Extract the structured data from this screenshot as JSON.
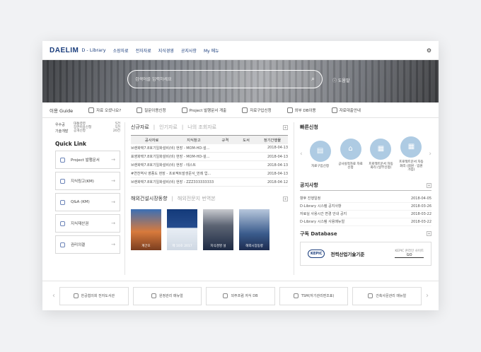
{
  "header": {
    "logo": "DAELIM",
    "logo_sub": "D - Library",
    "nav": [
      "소장자료",
      "전자자료",
      "지식경영",
      "공지사항",
      "My 메뉴"
    ]
  },
  "hero": {
    "search_placeholder": "검색어를 입력하세요",
    "help": "ⓘ 도움말"
  },
  "quickbar": {
    "guide": "이용 Guide",
    "items": [
      "자료 오셨나요?",
      "질문이용신청",
      "Project 발행문서 게출",
      "자료구입신청",
      "외부 DB이용",
      "자료대출안내"
    ]
  },
  "left": {
    "winner_tag1": "우수공",
    "winner_tag2": "기술개발",
    "winner_list": [
      {
        "name": "대통령령",
        "n": "5건"
      },
      {
        "name": "장관이용신청",
        "n": "5건"
      },
      {
        "name": "공개신청",
        "n": "20건"
      }
    ],
    "quicklink_title": "Quick Link",
    "quicklinks": [
      "Project 발행문서",
      "지식링고(KM)",
      "Q&A (KM)",
      "지식재산권",
      "권리의결"
    ]
  },
  "center": {
    "tabs": {
      "active": "신규자료",
      "t2": "인기자료",
      "t3": "나의 조회자료"
    },
    "table_headers": [
      "공사자료",
      "지식창고",
      "규격",
      "도서",
      "정기간행물"
    ],
    "rows": [
      {
        "title": "브랜화택7.8호기일화설비(비) 현장 - MOM-HD-설...",
        "date": "2018-04-13"
      },
      {
        "title": "표영화택7.8호기일화설비(비) 현장 - MOM-HD-설...",
        "date": "2018-04-13"
      },
      {
        "title": "브랜화택7.8호기일화설비(비) 현장 - 테스트",
        "date": "2018-04-13"
      },
      {
        "title": "#연천역사 영종도 현장 - 프로젝트발생문서_번례 업...",
        "date": "2018-04-13"
      },
      {
        "title": "브랜화택7.8호기일화설비(비) 현장 - ZZZ333333333",
        "date": "2018-04-12"
      }
    ],
    "tabs2": {
      "active": "해외건설시장동향",
      "t2": "해외전문지 번역본"
    },
    "books": [
      "계간호",
      "제 10호 2017",
      "지식경영 설",
      "해외시장동향"
    ]
  },
  "right": {
    "fav_title": "빠른신청",
    "favs": [
      "자료구입신청",
      "공사실적자료 자료신청",
      "프로젝트문서 자동화리 (일부신청)",
      "프로젝트문서 자동화리 (회원 · 입원가입)"
    ],
    "notice_title": "공지사항",
    "notices": [
      {
        "t": "향후 진행일정",
        "d": "2018-04-05"
      },
      {
        "t": "D-Library 시스템 공지사항",
        "d": "2018-03-26"
      },
      {
        "t": "자료실 사용시간 변경 안내 공지",
        "d": "2018-03-22"
      },
      {
        "t": "D-Library 시스템 사용매뉴얼",
        "d": "2018-03-22"
      }
    ],
    "db_title": "구독 Database",
    "db_name": "전력산업기술기준",
    "db_sub": "KEPIC 온라인 사이트",
    "db_logo": "KEPIC",
    "db_go": "GO"
  },
  "footer": {
    "items": [
      "한공협의회 전자도서관",
      "원정관리 매뉴얼",
      "외주프럼 자식 DB",
      "TSM(자기관리편조표)",
      "건축사문관리 매뉴얼"
    ]
  }
}
